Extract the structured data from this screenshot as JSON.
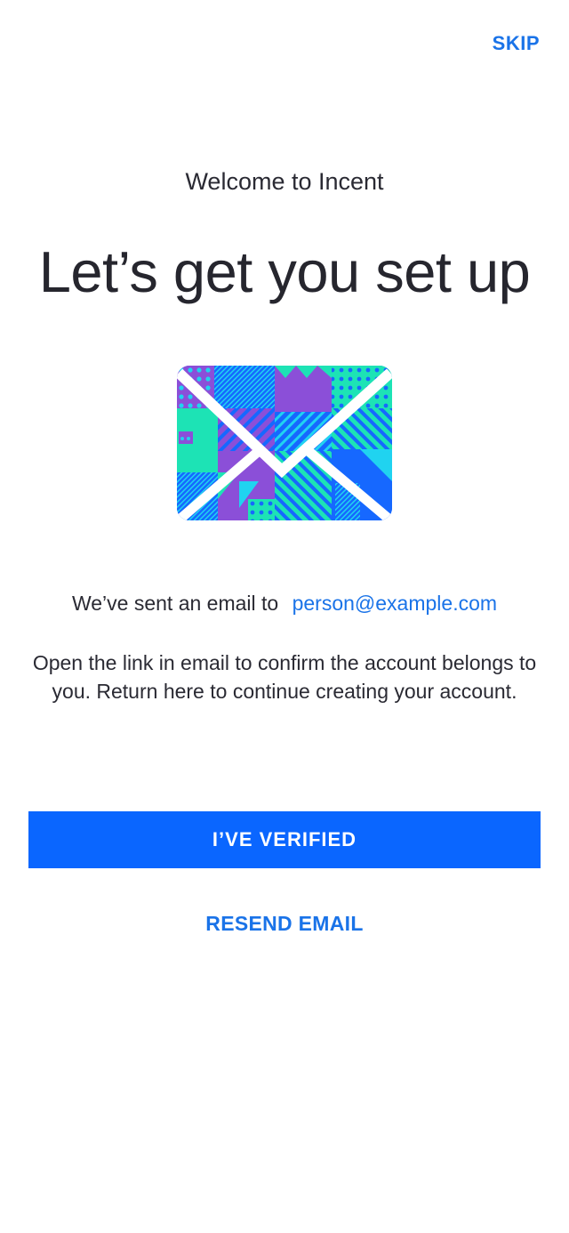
{
  "header": {
    "skip_label": "SKIP"
  },
  "main": {
    "welcome": "Welcome to Incent",
    "headline": "Let’s get you set up",
    "sent_prefix": "We’ve sent an email to",
    "email": "person@example.com",
    "instructions": "Open the link in email to confirm the account belongs to you. Return here to continue creating your account.",
    "envelope_icon": "envelope-icon"
  },
  "actions": {
    "verified_label": "I’VE VERIFIED",
    "resend_label": "RESEND EMAIL"
  },
  "colors": {
    "accent": "#1a73e8",
    "primary_button": "#0a66ff",
    "envelope_blue": "#1668ff",
    "envelope_purple": "#8b4fd8",
    "envelope_teal": "#1de3b5",
    "envelope_cyan": "#20d3f0"
  }
}
